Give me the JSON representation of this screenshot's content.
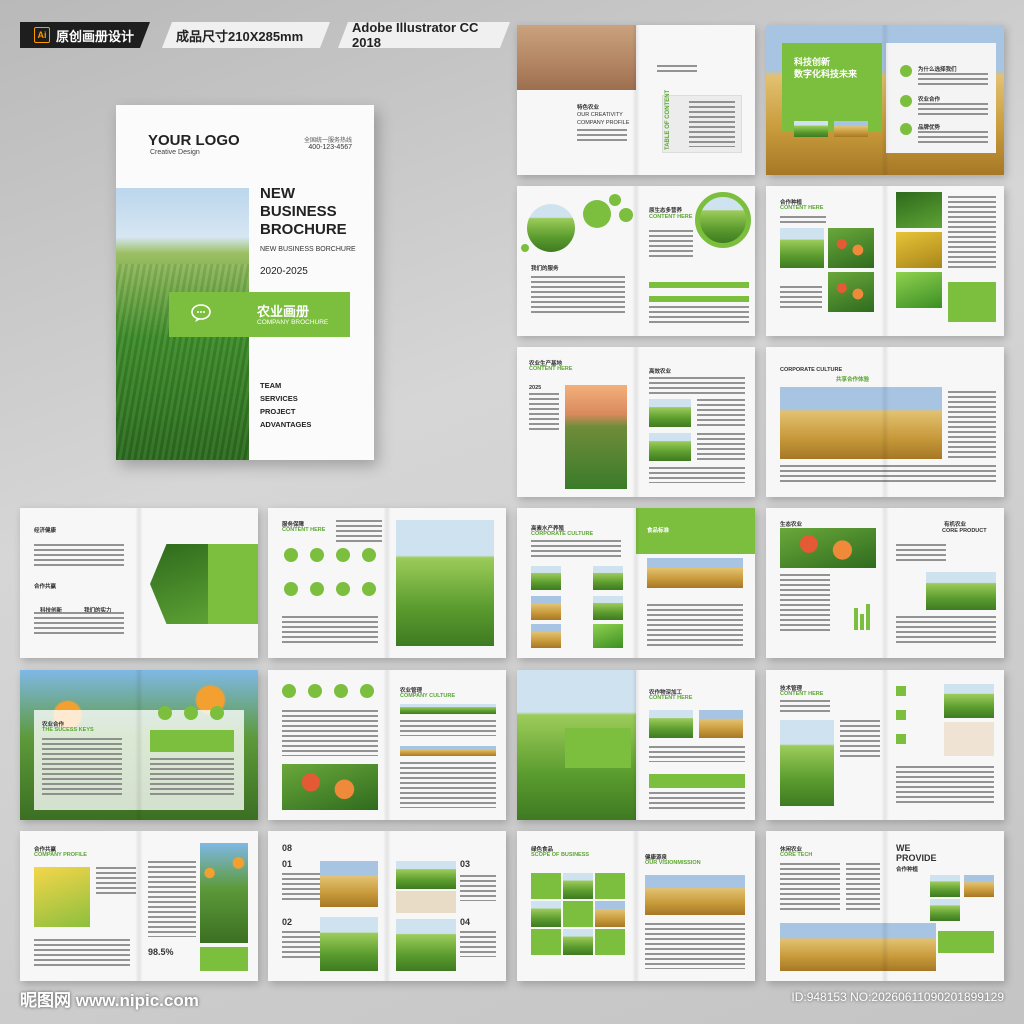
{
  "header": {
    "tag1": "原创画册设计",
    "tag1_icon": "Ai",
    "tag2": "成品尺寸210X285mm",
    "tag3": "Adobe Illustrator CC 2018"
  },
  "cover": {
    "logo": "YOUR LOGO",
    "logo_sub": "Creative Design",
    "hotline_label": "全国统一服务热线",
    "hotline": "400-123-4567",
    "title": "NEW BUSINESS BROCHURE",
    "subtitle": "NEW BUSINESS BORCHURE",
    "years": "2020-2025",
    "band_cn": "农业画册",
    "band_en": "COMPANY BROCHURE",
    "menu": [
      "TEAM",
      "SERVICES",
      "PROJECT",
      "ADVANTAGES"
    ]
  },
  "spreads": {
    "s1": {
      "cn": "特色农业",
      "en": "OUR CREATIVITY",
      "en2": "COMPANY PROFILE",
      "toc": "TABLE OF CONTENT"
    },
    "s2": {
      "cn1": "科技创新",
      "cn2": "数字化科技未来",
      "r1": "为什么选择我们",
      "r2": "农业合作",
      "r3": "品牌优势"
    },
    "s3": {
      "title": "原生态多营养",
      "sub": "CONTENT HERE",
      "left": "我们的服务"
    },
    "s4": {
      "title": "合作种植",
      "sub": "CONTENT HERE"
    },
    "s5": {
      "title": "农业生产基地",
      "sub": "CONTENT HERE",
      "year": "2025",
      "right": "高效农业"
    },
    "s6": {
      "title": "CORPORATE CULTURE",
      "cn": "共享合作体验"
    },
    "s7": {
      "l1": "经济健康",
      "l2": "合作共赢",
      "l3": "科技创新",
      "l4": "我们的实力"
    },
    "s8": {
      "title": "服务保障",
      "sub": "CONTENT HERE"
    },
    "s9": {
      "title": "高素水产养殖",
      "sub": "CORPORATE CULTURE",
      "right": "食品标准"
    },
    "s10": {
      "title": "生态农业",
      "right": "有机农业",
      "right_en": "CORE PRODUCT"
    },
    "s11": {
      "title": "农业合作",
      "sub": "THE SUCESS KEYS"
    },
    "s12": {
      "title": "农业管理",
      "sub": "COMPANY CULTURE"
    },
    "s13": {
      "title": "农作物深加工",
      "sub": "CONTENT HERE"
    },
    "s14": {
      "title": "技术管理",
      "sub": "CONTENT HERE"
    },
    "s15": {
      "title": "合作共赢",
      "sub": "COMPANY PROFILE",
      "stat": "98.5%"
    },
    "s16": {
      "n1": "08",
      "n2": "01",
      "n3": "02",
      "n4": "03",
      "n5": "04"
    },
    "s17": {
      "title": "绿色食品",
      "sub": "SCOPE OF BUSINESS",
      "right": "健康源泉",
      "right_sub": "OUR VISIONMISSION"
    },
    "s18": {
      "title": "休闲农业",
      "sub": "CORE TECH",
      "right1": "WE",
      "right2": "PROVIDE",
      "right3": "合作种植"
    }
  },
  "footer": {
    "watermark": "昵图网 www.nipic.com",
    "id": "ID:948153 NO:20260611090201899129"
  },
  "colors": {
    "accent": "#7cbf3e",
    "dark": "#1e1e1e"
  }
}
